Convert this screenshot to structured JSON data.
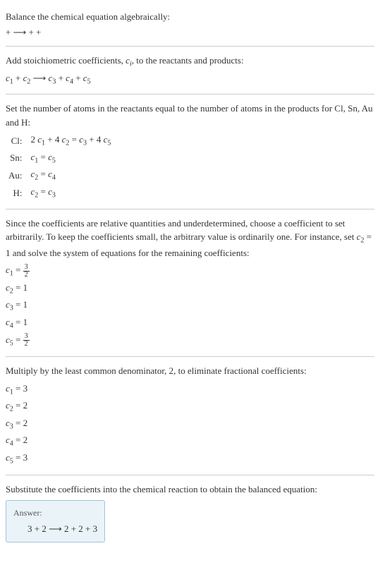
{
  "section1": {
    "title": "Balance the chemical equation algebraically:",
    "eq": " +  ⟶  +  + "
  },
  "section2": {
    "title_part1": "Add stoichiometric coefficients, ",
    "title_ci": "c",
    "title_ci_sub": "i",
    "title_part2": ", to the reactants and products:",
    "c1": "c",
    "s1": "1",
    "plus1": "  + ",
    "c2": "c",
    "s2": "2",
    "arrow": "   ⟶ ",
    "c3": "c",
    "s3": "3",
    "plus3": "  + ",
    "c4": "c",
    "s4": "4",
    "plus4": "  + ",
    "c5": "c",
    "s5": "5"
  },
  "section3": {
    "title": "Set the number of atoms in the reactants equal to the number of atoms in the products for Cl, Sn, Au and H:",
    "rows": [
      {
        "el": "Cl:",
        "a": "2 ",
        "c1": "c",
        "s1": "1",
        "mid1": " + 4 ",
        "c2": "c",
        "s2": "2",
        "eq": " = ",
        "c3": "c",
        "s3": "3",
        "mid2": " + 4 ",
        "c4": "c",
        "s4": "5"
      },
      {
        "el": "Sn:",
        "a": "",
        "c1": "c",
        "s1": "1",
        "mid1": "",
        "c2": "",
        "s2": "",
        "eq": " = ",
        "c3": "c",
        "s3": "5",
        "mid2": "",
        "c4": "",
        "s4": ""
      },
      {
        "el": "Au:",
        "a": "",
        "c1": "c",
        "s1": "2",
        "mid1": "",
        "c2": "",
        "s2": "",
        "eq": " = ",
        "c3": "c",
        "s3": "4",
        "mid2": "",
        "c4": "",
        "s4": ""
      },
      {
        "el": "H:",
        "a": "",
        "c1": "c",
        "s1": "2",
        "mid1": "",
        "c2": "",
        "s2": "",
        "eq": " = ",
        "c3": "c",
        "s3": "3",
        "mid2": "",
        "c4": "",
        "s4": ""
      }
    ]
  },
  "section4": {
    "title_p1": "Since the coefficients are relative quantities and underdetermined, choose a coefficient to set arbitrarily. To keep the coefficients small, the arbitrary value is ordinarily one. For instance, set ",
    "title_c": "c",
    "title_s": "2",
    "title_p2": " = 1 and solve the system of equations for the remaining coefficients:",
    "rows": [
      {
        "c": "c",
        "s": "1",
        "eq": " = ",
        "val": "",
        "frac_num": "3",
        "frac_den": "2"
      },
      {
        "c": "c",
        "s": "2",
        "eq": " = ",
        "val": "1",
        "frac_num": "",
        "frac_den": ""
      },
      {
        "c": "c",
        "s": "3",
        "eq": " = ",
        "val": "1",
        "frac_num": "",
        "frac_den": ""
      },
      {
        "c": "c",
        "s": "4",
        "eq": " = ",
        "val": "1",
        "frac_num": "",
        "frac_den": ""
      },
      {
        "c": "c",
        "s": "5",
        "eq": " = ",
        "val": "",
        "frac_num": "3",
        "frac_den": "2"
      }
    ]
  },
  "section5": {
    "title": "Multiply by the least common denominator, 2, to eliminate fractional coefficients:",
    "rows": [
      {
        "c": "c",
        "s": "1",
        "eq": " = ",
        "val": "3"
      },
      {
        "c": "c",
        "s": "2",
        "eq": " = ",
        "val": "2"
      },
      {
        "c": "c",
        "s": "3",
        "eq": " = ",
        "val": "2"
      },
      {
        "c": "c",
        "s": "4",
        "eq": " = ",
        "val": "2"
      },
      {
        "c": "c",
        "s": "5",
        "eq": " = ",
        "val": "3"
      }
    ]
  },
  "section6": {
    "title": "Substitute the coefficients into the chemical reaction to obtain the balanced equation:"
  },
  "answer": {
    "label": "Answer:",
    "content": "3  + 2  ⟶ 2  + 2  + 3 "
  }
}
